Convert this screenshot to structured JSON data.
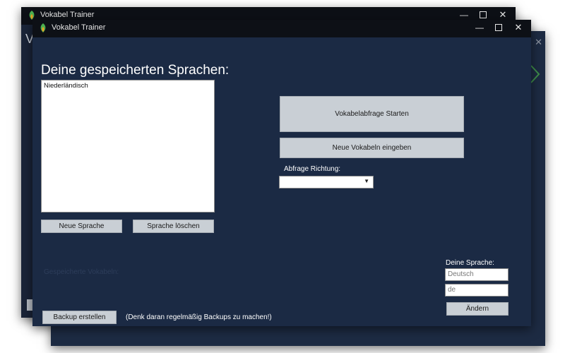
{
  "background_windows": [
    {
      "title": "Vokabel Trainer",
      "visible_letter": "V",
      "minimize": "—",
      "close": "✕"
    },
    {
      "close": "✕"
    }
  ],
  "window": {
    "title": "Vokabel Trainer",
    "minimize": "—",
    "close": "✕"
  },
  "languages": {
    "heading": "Deine gespeicherten Sprachen:",
    "items": [
      "Niederländisch"
    ],
    "new_button": "Neue Sprache",
    "delete_button": "Sprache löschen"
  },
  "actions": {
    "start_button": "Vokabelabfrage Starten",
    "new_vocab_button": "Neue Vokabeln eingeben",
    "direction_label": "Abfrage Richtung:",
    "direction_value": ""
  },
  "saved_vocab_label": "Gespeicherte Vokabeln:",
  "own_language": {
    "label": "Deine Sprache:",
    "language_placeholder": "Deutsch",
    "code_placeholder": "de",
    "change_button": "Ändern"
  },
  "backup": {
    "button": "Backup erstellen",
    "hint": "(Denk daran regelmäßig Backups zu machen!)"
  },
  "colors": {
    "window_bg": "#1b2a44",
    "titlebar_bg": "#0d1016",
    "button_bg": "#c9cfd5",
    "text_white": "#ffffff",
    "icon_green": "#4caf50",
    "icon_orange": "#f0a020"
  }
}
